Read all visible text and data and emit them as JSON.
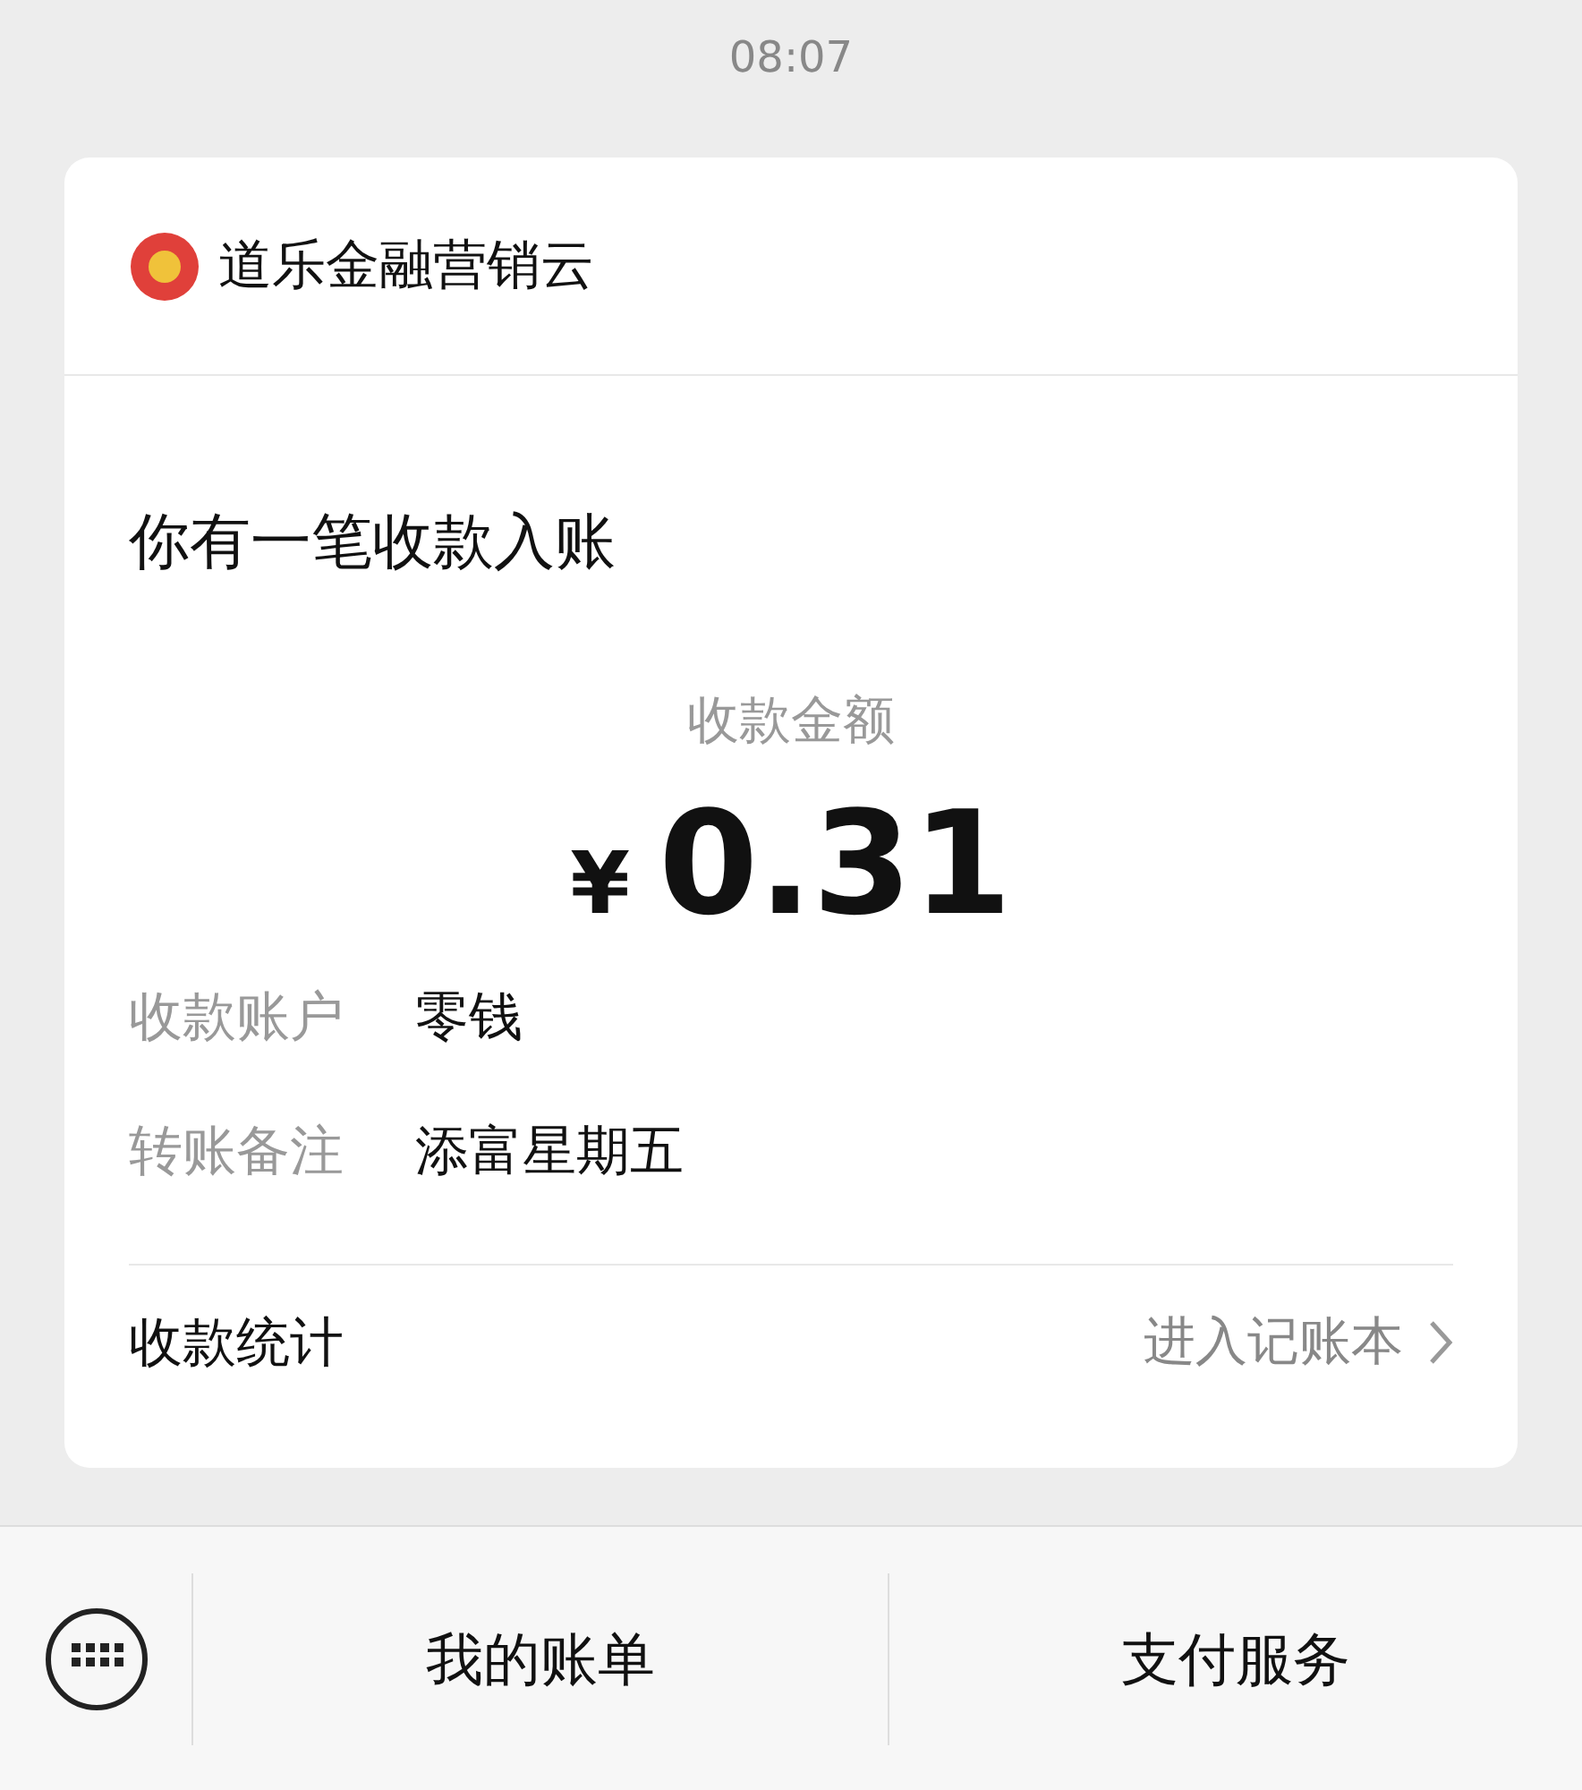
{
  "status_bar": {
    "time": "08:07"
  },
  "message": {
    "sender": "道乐金融营销云",
    "title": "你有一笔收款入账",
    "amount_label": "收款金额",
    "currency": "¥",
    "amount": "0.31",
    "fields": [
      {
        "label": "收款账户",
        "value": "零钱"
      },
      {
        "label": "转账备注",
        "value": "添富星期五"
      }
    ],
    "footer": {
      "label": "收款统计",
      "link": "进入记账本"
    }
  },
  "bottom_menu": [
    "我的账单",
    "支付服务"
  ]
}
